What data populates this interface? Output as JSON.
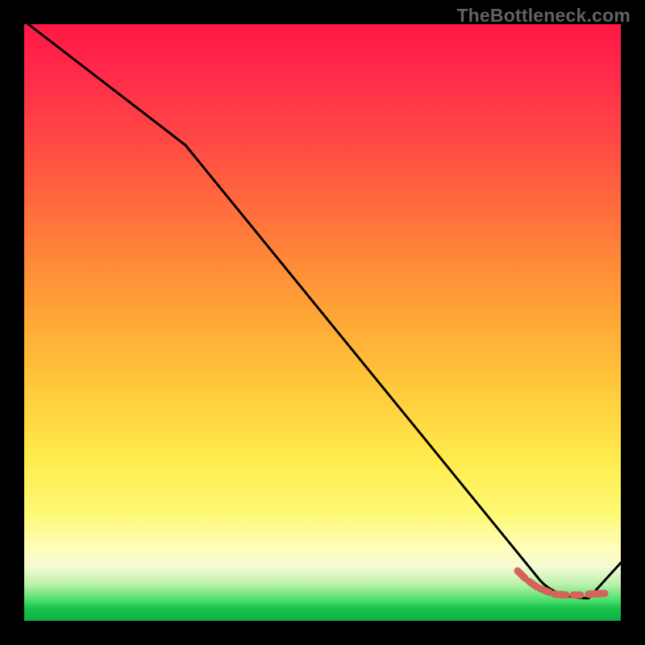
{
  "watermark": "TheBottleneck.com",
  "colors": {
    "gradient_top": "#ff1744",
    "gradient_mid": "#ffe94a",
    "gradient_bottom": "#0fae43",
    "curve": "#000000",
    "marker": "#d2645a",
    "frame": "#000000"
  },
  "chart_data": {
    "type": "line",
    "title": "",
    "xlabel": "",
    "ylabel": "",
    "xlim": [
      0,
      100
    ],
    "ylim": [
      0,
      100
    ],
    "grid": false,
    "legend": false,
    "series": [
      {
        "name": "bottleneck-curve",
        "x": [
          0,
          27,
          86,
          95,
          100
        ],
        "y": [
          100,
          80,
          7,
          4,
          10
        ]
      }
    ],
    "highlight_range_x": [
      83,
      97
    ],
    "background_gradient_vertical": [
      {
        "pos": 0.0,
        "color": "#ff1744"
      },
      {
        "pos": 0.35,
        "color": "#ff7a3a"
      },
      {
        "pos": 0.72,
        "color": "#ffe94a"
      },
      {
        "pos": 0.91,
        "color": "#f4fad2"
      },
      {
        "pos": 1.0,
        "color": "#0fae43"
      }
    ]
  }
}
